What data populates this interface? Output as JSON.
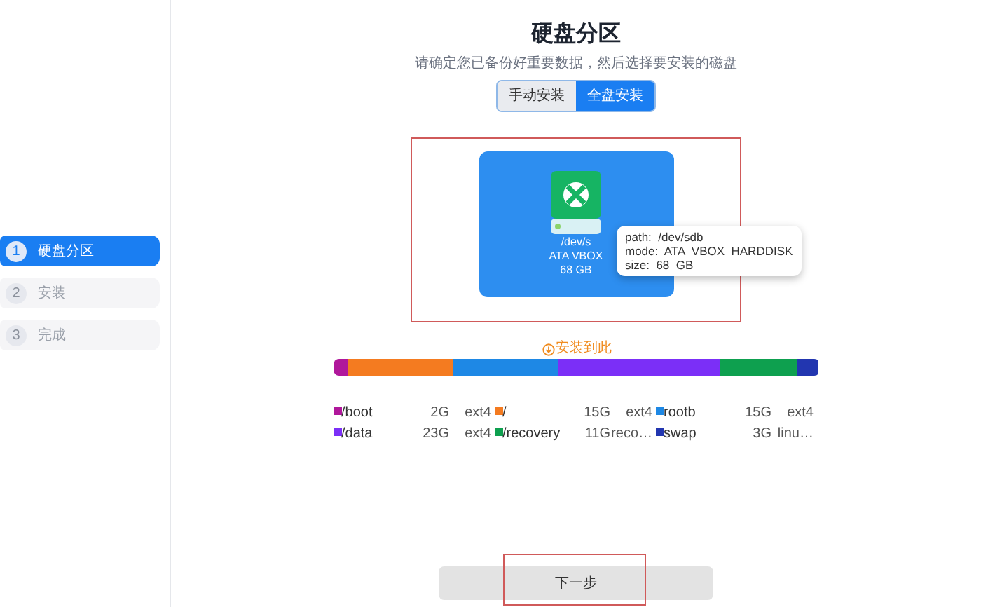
{
  "sidebar": {
    "steps": [
      {
        "number": "1",
        "label": "硬盘分区",
        "selected": true
      },
      {
        "number": "2",
        "label": "安装",
        "selected": false
      },
      {
        "number": "3",
        "label": "完成",
        "selected": false
      }
    ]
  },
  "title": "硬盘分区",
  "subtitle": "请确定您已备份好重要数据，然后选择要安装的磁盘",
  "mode_toggle": [
    {
      "label": "手动安装",
      "selected": false
    },
    {
      "label": "全盘安装",
      "selected": true
    }
  ],
  "disk": {
    "lines": [
      "/dev/s",
      "ATA VBOX",
      "68 GB"
    ],
    "selected": true,
    "tooltip": [
      "path:  /dev/sdb",
      "mode:  ATA  VBOX  HARDDISK",
      "size:  68  GB"
    ]
  },
  "install_marker": "安装到此",
  "partitions": [
    {
      "name": "/boot",
      "size": "2G",
      "fs": "ext4",
      "color": "#b0179b"
    },
    {
      "name": "/",
      "size": "15G",
      "fs": "ext4",
      "color": "#f47b20"
    },
    {
      "name": "rootb",
      "size": "15G",
      "fs": "ext4",
      "color": "#1e88e5"
    },
    {
      "name": "/data",
      "size": "23G",
      "fs": "ext4",
      "color": "#7b2ff7"
    },
    {
      "name": "/recovery",
      "size": "11G",
      "fs": "reco…",
      "color": "#0ea04f"
    },
    {
      "name": "swap",
      "size": "3G",
      "fs": "linu…",
      "color": "#2236b0"
    }
  ],
  "next_button": "下一步"
}
